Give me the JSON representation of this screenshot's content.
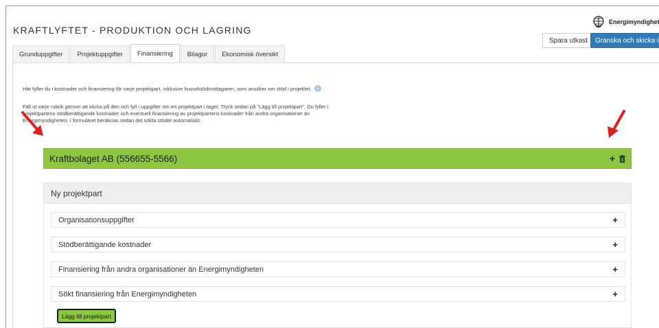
{
  "header": {
    "title": "KRAFTLYFTET - PRODUKTION OCH LAGRING",
    "logo_text": "Energimyndigheten",
    "save_draft_label": "Spara utkast",
    "submit_label": "Granska och skicka in"
  },
  "tabs": [
    {
      "label": "Grunduppgifter",
      "active": false
    },
    {
      "label": "Projektuppgifter",
      "active": false
    },
    {
      "label": "Finansiering",
      "active": true
    },
    {
      "label": "Bilagor",
      "active": false
    },
    {
      "label": "Ekonomisk översikt",
      "active": false
    }
  ],
  "content": {
    "intro": "Här fyller du i kostnader och finansiering för varje projektpart, inklusive huvudstödmottagaren, som ansöker om stöd i projektet.",
    "instructions": [
      "Fäll ut varje rubrik genom att klicka på den och fyll i uppgifter om en projektpart i taget. Tryck sedan på \"Lägg till projektpart\". Du fyller i",
      "projektpartens stödberättigande kostnader och eventuell finansiering av projektpartens kostnader från andra organisationer än",
      "Energimyndigheten. I formuläret beräknas sedan det sökta stödet automatiskt."
    ],
    "party": {
      "name": "Kraftbolaget AB (556655-5566)",
      "add_icon": "plus-icon",
      "delete_icon": "trash-icon"
    },
    "new_party": {
      "heading": "Ny projektpart",
      "sections": [
        {
          "label": "Organisationsuppgifter"
        },
        {
          "label": "Stödberättigande kostnader"
        },
        {
          "label": "Finansiering från andra organisationer än Energimyndigheten"
        },
        {
          "label": "Sökt finansiering från Energimyndigheten"
        }
      ],
      "add_button_label": "Lägg till projektpart"
    }
  },
  "colors": {
    "accent_green": "#8dc63f",
    "primary_blue": "#337ab7",
    "arrow_red": "#e0201c"
  }
}
